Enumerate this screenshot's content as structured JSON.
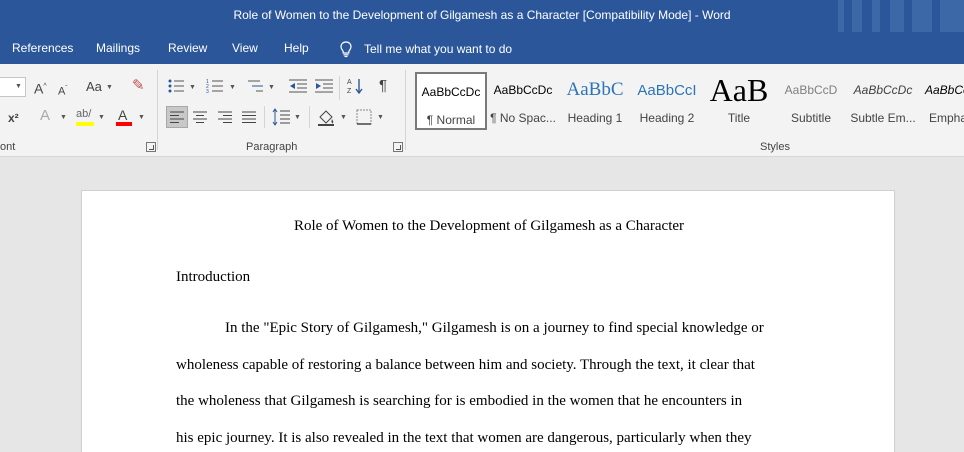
{
  "window": {
    "title": "Role of Women to the Development of Gilgamesh as a Character [Compatibility Mode]  -  Word"
  },
  "ribbon_tabs": [
    "References",
    "Mailings",
    "Review",
    "View",
    "Help"
  ],
  "tell_me": "Tell me what you want to do",
  "groups": {
    "font_label": "ont",
    "paragraph_label": "Paragraph",
    "styles_label": "Styles"
  },
  "styles": [
    {
      "preview": "AaBbCcDc",
      "label": "¶ Normal",
      "selected": true
    },
    {
      "preview": "AaBbCcDc",
      "label": "¶ No Spac..."
    },
    {
      "preview": "AaBbC",
      "label": "Heading 1"
    },
    {
      "preview": "AaBbCcI",
      "label": "Heading 2"
    },
    {
      "preview": "AaB",
      "label": "Title"
    },
    {
      "preview": "AaBbCcD",
      "label": "Subtitle"
    },
    {
      "preview": "AaBbCcDc",
      "label": "Subtle Em..."
    },
    {
      "preview": "AaBbCc",
      "label": "Empha"
    }
  ],
  "document": {
    "title": "Role of Women to the Development of Gilgamesh as a Character",
    "heading": "Introduction",
    "lines": [
      "In the \"Epic Story of Gilgamesh,\" Gilgamesh is on a journey to find special knowledge or",
      "wholeness capable of restoring a balance between him and society. Through the text, it clear that",
      "the wholeness that Gilgamesh is searching for is embodied in the women that he encounters in",
      "his epic journey. It is also revealed in the text that women are dangerous, particularly when they"
    ]
  },
  "colors": {
    "brand": "#2b579a",
    "highlight": "#ffff00",
    "font_color": "#ff0000",
    "heading_style": "#2e74b5"
  },
  "icons": [
    "grow-font-icon",
    "shrink-font-icon",
    "change-case-icon",
    "clear-formatting-icon",
    "superscript-icon",
    "text-effects-icon",
    "highlight-icon",
    "font-color-icon",
    "bullets-icon",
    "numbering-icon",
    "multilevel-list-icon",
    "decrease-indent-icon",
    "increase-indent-icon",
    "sort-icon",
    "show-marks-icon",
    "align-left-icon",
    "center-icon",
    "align-right-icon",
    "justify-icon",
    "line-spacing-icon",
    "shading-icon",
    "borders-icon",
    "lightbulb-icon"
  ]
}
